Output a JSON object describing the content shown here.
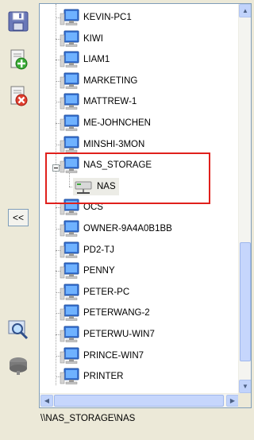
{
  "toolbar": {
    "buttons": [
      {
        "name": "save",
        "icon": "floppy-disk-icon"
      },
      {
        "name": "add",
        "icon": "add-document-icon"
      },
      {
        "name": "delete",
        "icon": "delete-document-icon"
      },
      {
        "name": "search",
        "icon": "magnifier-icon"
      },
      {
        "name": "disconnect",
        "icon": "network-drive-icon"
      }
    ],
    "collapse_label": "<<"
  },
  "tree": {
    "items": [
      {
        "label": "KEVIN-PC1",
        "icon": "computer-icon"
      },
      {
        "label": "KIWI",
        "icon": "computer-icon"
      },
      {
        "label": "LIAM1",
        "icon": "computer-icon"
      },
      {
        "label": "MARKETING",
        "icon": "computer-icon"
      },
      {
        "label": "MATTREW-1",
        "icon": "computer-icon"
      },
      {
        "label": "ME-JOHNCHEN",
        "icon": "computer-icon"
      },
      {
        "label": "MINSHI-3MON",
        "icon": "computer-icon"
      },
      {
        "label": "NAS_STORAGE",
        "icon": "computer-icon",
        "expanded": true
      },
      {
        "label": "NAS",
        "icon": "network-share-icon",
        "child": true,
        "selected": true
      },
      {
        "label": "OCS",
        "icon": "computer-icon"
      },
      {
        "label": "OWNER-9A4A0B1BB",
        "icon": "computer-icon"
      },
      {
        "label": "PD2-TJ",
        "icon": "computer-icon"
      },
      {
        "label": "PENNY",
        "icon": "computer-icon"
      },
      {
        "label": "PETER-PC",
        "icon": "computer-icon"
      },
      {
        "label": "PETERWANG-2",
        "icon": "computer-icon"
      },
      {
        "label": "PETERWU-WIN7",
        "icon": "computer-icon"
      },
      {
        "label": "PRINCE-WIN7",
        "icon": "computer-icon"
      },
      {
        "label": "PRINTER",
        "icon": "computer-icon"
      }
    ]
  },
  "path_text": "\\\\NAS_STORAGE\\NAS",
  "colors": {
    "highlight_border": "#e0201c",
    "panel_border": "#7f9db9",
    "window_bg": "#ece9d8",
    "scrollbar": "#c6d6fc"
  }
}
